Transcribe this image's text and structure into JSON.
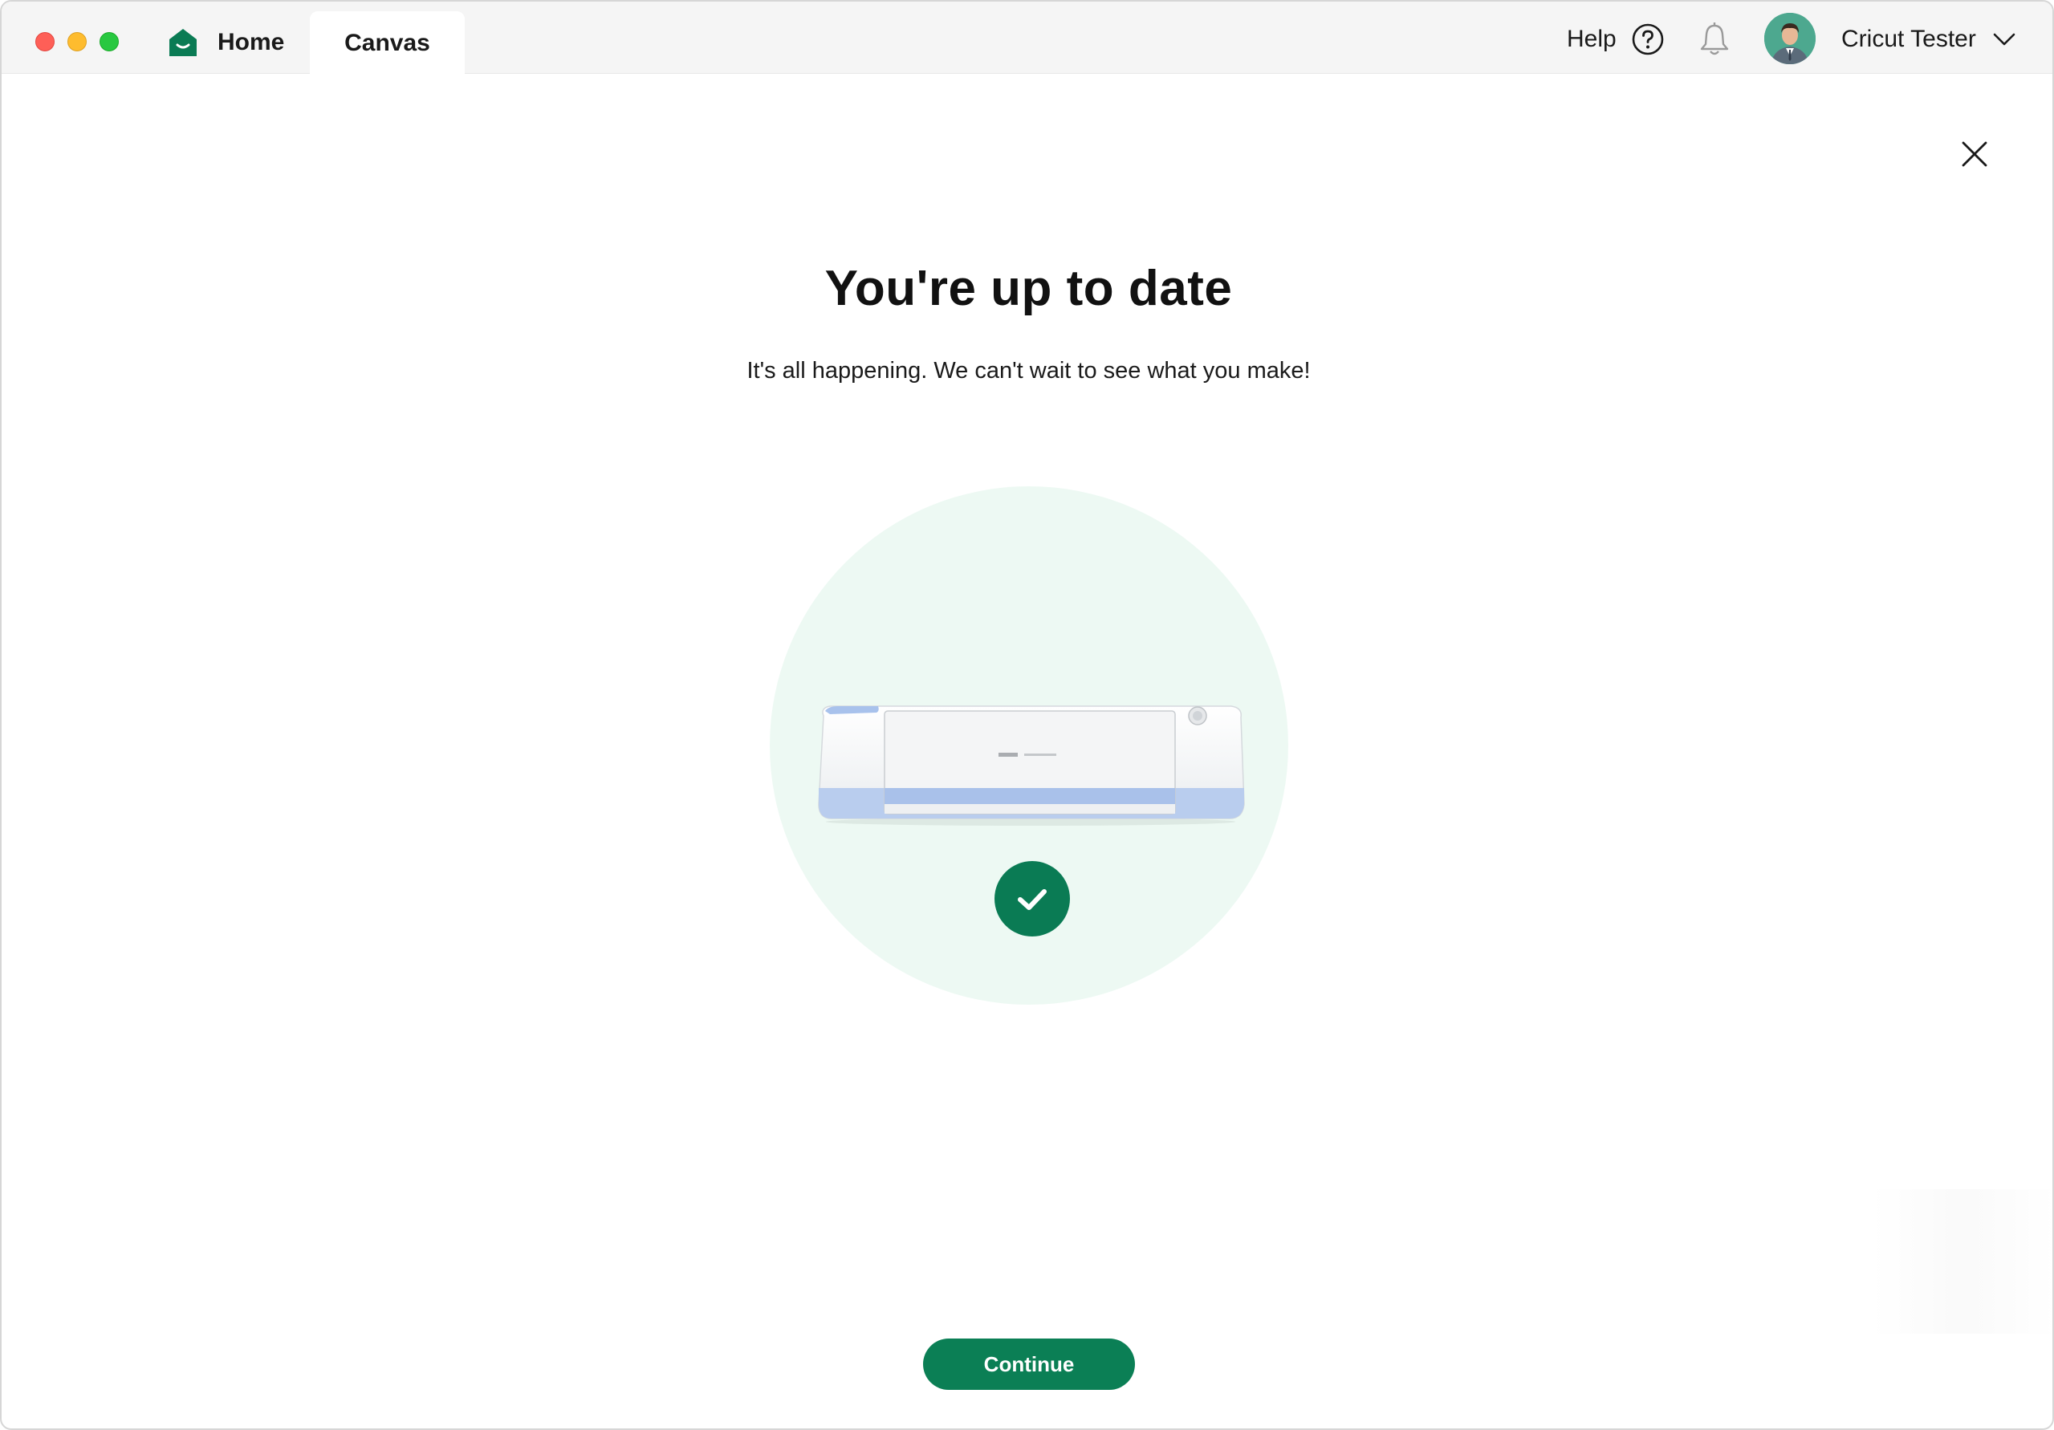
{
  "window": {
    "tabs": [
      {
        "label": "Home"
      },
      {
        "label": "Canvas"
      }
    ]
  },
  "header": {
    "help_label": "Help",
    "user_name": "Cricut Tester"
  },
  "dialog": {
    "title": "You're up to date",
    "subtitle": "It's all happening. We can't wait to see what you make!",
    "continue_label": "Continue"
  },
  "colors": {
    "brand_green": "#0b7f55",
    "hero_circle": "#edf9f3",
    "titlebar": "#f5f5f5"
  },
  "icons": [
    "home-icon",
    "help-icon",
    "bell-icon",
    "avatar",
    "chevron-down-icon",
    "close-icon",
    "check-icon"
  ]
}
